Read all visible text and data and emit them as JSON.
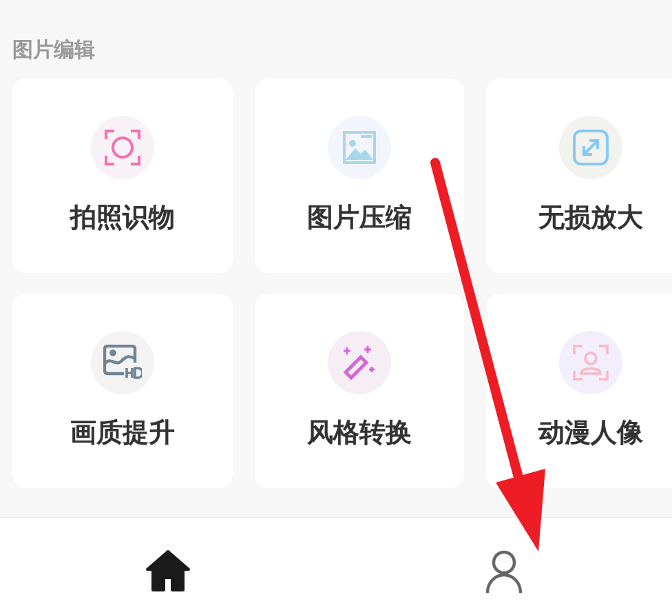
{
  "section": {
    "title": "图片编辑"
  },
  "tools": [
    {
      "label": "拍照识物",
      "kind": "scan"
    },
    {
      "label": "图片压缩",
      "kind": "compress"
    },
    {
      "label": "无损放大",
      "kind": "enlarge"
    },
    {
      "label": "画质提升",
      "kind": "hd"
    },
    {
      "label": "风格转换",
      "kind": "wand"
    },
    {
      "label": "动漫人像",
      "kind": "portrait"
    }
  ],
  "tab_bar": [
    {
      "kind": "home",
      "selected": true
    },
    {
      "kind": "profile",
      "selected": false
    }
  ]
}
